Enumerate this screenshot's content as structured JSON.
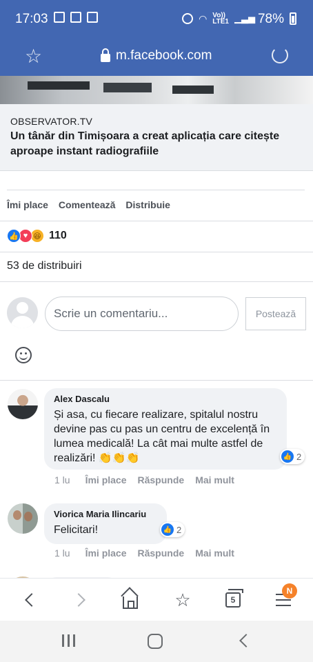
{
  "status_bar": {
    "time": "17:03",
    "network_label": "Vo))\nLTE1",
    "battery_pct": "78%"
  },
  "browser": {
    "url": "m.facebook.com"
  },
  "post": {
    "link_source": "OBSERVATOR.TV",
    "link_title": "Un tânăr din Timișoara a creat aplicația care citește aproape instant radiografiile",
    "actions": {
      "like": "Îmi place",
      "comment": "Comentează",
      "share": "Distribuie"
    },
    "reaction_count": "110",
    "shares_text": "53 de distribuiri"
  },
  "composer": {
    "placeholder": "Scrie un comentariu...",
    "post_label": "Postează"
  },
  "comments": [
    {
      "author": "Alex Dascalu",
      "text": "Și asa, cu fiecare realizare, spitalul nostru devine pas cu pas un centru de excelență în lumea medicală! La cât mai multe astfel de realizări! 👏👏👏",
      "likes": "2",
      "time": "1 lu",
      "like_label": "Îmi place",
      "reply_label": "Răspunde",
      "more_label": "Mai mult"
    },
    {
      "author": "Viorica Maria Ilincariu",
      "text": "Felicitari!",
      "likes": "2",
      "time": "1 lu",
      "like_label": "Îmi place",
      "reply_label": "Răspunde",
      "more_label": "Mai mult"
    }
  ],
  "bottom_nav": {
    "tabs_count": "5",
    "menu_badge": "N"
  },
  "colors": {
    "facebook_blue": "#4267b2",
    "like_blue": "#1877f2",
    "badge_orange": "#f5822a"
  }
}
